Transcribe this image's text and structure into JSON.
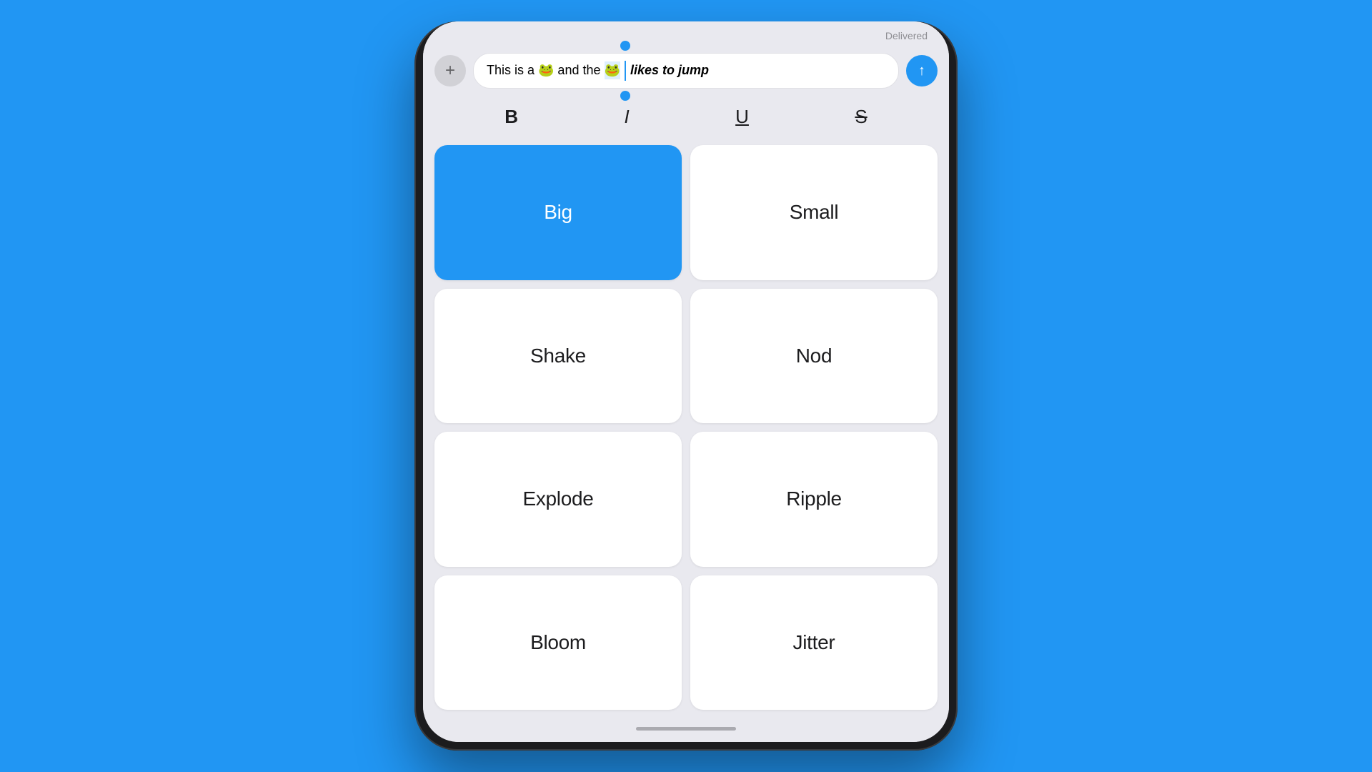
{
  "status": {
    "delivered": "Delivered"
  },
  "input": {
    "text_before": "This is a 🐸 and the",
    "text_emoji": "🐸",
    "text_italic": " likes to jump",
    "full_text": "This is a 🐸 and the 🐸 likes to jump"
  },
  "toolbar": {
    "add_label": "+",
    "send_icon": "↑",
    "bold_label": "B",
    "italic_label": "I",
    "underline_label": "U",
    "strikethrough_label": "S"
  },
  "animations": [
    {
      "id": "big",
      "label": "Big",
      "active": true
    },
    {
      "id": "small",
      "label": "Small",
      "active": false
    },
    {
      "id": "shake",
      "label": "Shake",
      "active": false
    },
    {
      "id": "nod",
      "label": "Nod",
      "active": false
    },
    {
      "id": "explode",
      "label": "Explode",
      "active": false
    },
    {
      "id": "ripple",
      "label": "Ripple",
      "active": false
    },
    {
      "id": "bloom",
      "label": "Bloom",
      "active": false
    },
    {
      "id": "jitter",
      "label": "Jitter",
      "active": false
    }
  ],
  "colors": {
    "blue": "#2196F3",
    "background": "#2196F3",
    "active_btn": "#2196F3",
    "inactive_btn": "#ffffff"
  }
}
